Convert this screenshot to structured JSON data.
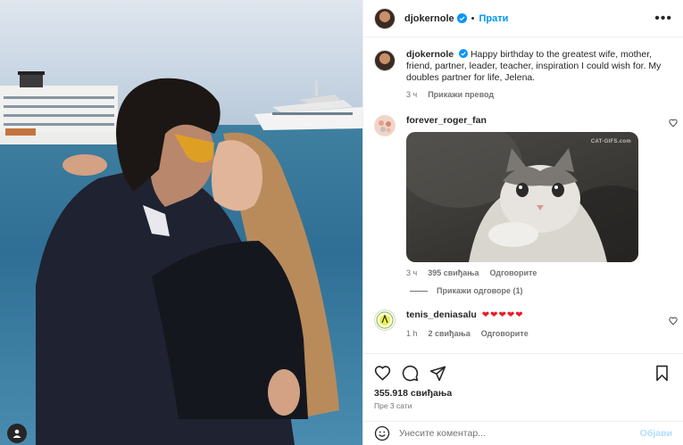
{
  "post": {
    "username": "djokernole",
    "follow_label": "Прати",
    "more_label": "•••"
  },
  "caption": {
    "username": "djokernole",
    "text": "Happy birthday to the greatest wife, mother, friend, partner, leader, teacher, inspiration I could wish for. My doubles partner for life, Jelena.",
    "time": "3 ч",
    "translate_label": "Прикажи превод"
  },
  "comments": [
    {
      "username": "forever_roger_fan",
      "time": "3 ч",
      "likes": "395 свиђања",
      "reply_label": "Одговорите",
      "gif_watermark": "CAT-GIFS.com",
      "view_replies": "Прикажи одговоре (1)"
    },
    {
      "username": "tenis_deniasalu",
      "hearts": "❤❤❤❤❤",
      "time": "1 h",
      "likes": "2 свиђања",
      "reply_label": "Одговорите"
    }
  ],
  "stats": {
    "likes": "355.918 свиђања",
    "time": "Пре 3 сати"
  },
  "add_comment": {
    "placeholder": "Унесите коментар...",
    "post_label": "Објави"
  },
  "icons": [
    "like-icon",
    "comment-icon",
    "share-icon",
    "save-icon",
    "emoji-icon",
    "more-icon",
    "verified-icon",
    "user-tag-icon"
  ],
  "colors": {
    "accent": "#0095f6",
    "heart": "#ed1c24",
    "muted": "#737373",
    "text": "#262626"
  }
}
